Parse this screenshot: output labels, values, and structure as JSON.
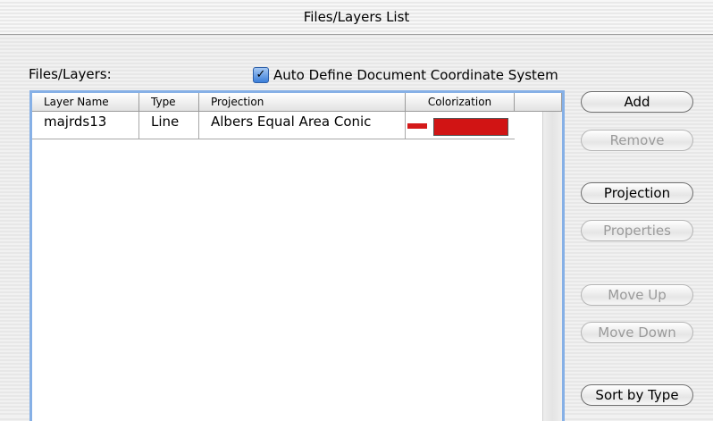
{
  "window": {
    "title": "Files/Layers List"
  },
  "labels": {
    "files_layers": "Files/Layers:",
    "auto_define": "Auto Define Document Coordinate System"
  },
  "table": {
    "headers": [
      "Layer Name",
      "Type",
      "Projection",
      "Colorization"
    ],
    "rows": [
      {
        "layer_name": "majrds13",
        "type": "Line",
        "projection": "Albers Equal Area Conic",
        "colorization_color": "#d11414"
      }
    ]
  },
  "buttons": {
    "add": "Add",
    "remove": "Remove",
    "projection": "Projection",
    "properties": "Properties",
    "move_up": "Move Up",
    "move_down": "Move Down",
    "sort_by_type": "Sort by Type"
  },
  "state": {
    "auto_define_checked": true,
    "disabled_buttons": [
      "remove",
      "properties",
      "move_up",
      "move_down"
    ]
  },
  "colors": {
    "selection_border": "#86b0e6",
    "swatch_red": "#d11414"
  }
}
